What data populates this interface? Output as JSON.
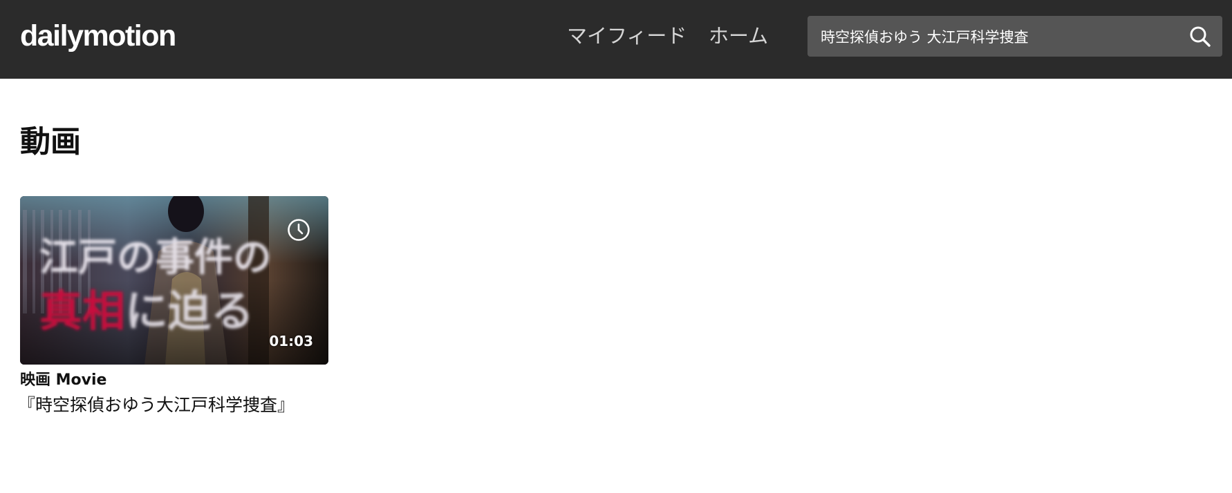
{
  "header": {
    "logo_text": "dailymotion",
    "nav": {
      "feed_label": "マイフィード",
      "home_label": "ホーム"
    },
    "search": {
      "value": "時空探偵おゆう 大江戸科学捜査",
      "icon": "search-icon"
    }
  },
  "main": {
    "section_title": "動画",
    "videos": [
      {
        "thumbnail_text_line1": "江戸の事件の",
        "thumbnail_text_line2_red": "真相",
        "thumbnail_text_line2_white": "に迫る",
        "duration": "01:03",
        "watch_later_icon": "clock-icon",
        "channel": "映画 Movie",
        "title": "『時空探偵おゆう大江戸科学捜査』"
      }
    ]
  },
  "colors": {
    "header_bg": "#2b2b2b",
    "search_bg": "#555555",
    "nav_text": "#d6d6d6",
    "page_bg": "#ffffff",
    "thumb_red_text": "#c8103e"
  }
}
